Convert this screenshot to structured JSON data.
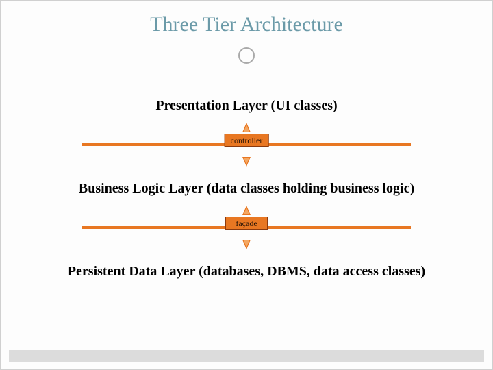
{
  "title": "Three Tier Architecture",
  "layers": {
    "presentation": "Presentation Layer (UI classes)",
    "business": "Business Logic Layer (data classes holding business logic)",
    "persistent": "Persistent Data Layer (databases, DBMS, data access classes)"
  },
  "connectors": {
    "controller": "controller",
    "facade": "façade"
  },
  "colors": {
    "accent": "#e87722",
    "title": "#6b9aa8"
  }
}
